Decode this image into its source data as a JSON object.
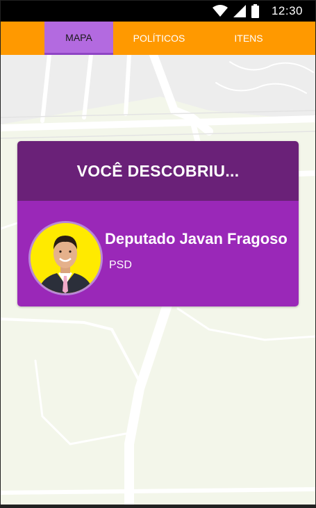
{
  "status_bar": {
    "time": "12:30",
    "icons": [
      "wifi-icon",
      "cellular-signal-icon",
      "battery-icon"
    ]
  },
  "tabs": [
    {
      "label": "MAPA",
      "active": true
    },
    {
      "label": "POLÍTICOS",
      "active": false
    },
    {
      "label": "ITENS",
      "active": false
    }
  ],
  "colors": {
    "tabbar": "#ff9900",
    "active_tab": "#b36ae0",
    "card_header": "#6a2178",
    "card_body": "#9a28b8",
    "avatar_bg": "#ffea00",
    "map_bg": "#f3f6ea"
  },
  "discovery_card": {
    "title": "VOCÊ DESCOBRIU...",
    "politician": {
      "name": "Deputado Javan Fragoso",
      "party": "PSD"
    }
  }
}
